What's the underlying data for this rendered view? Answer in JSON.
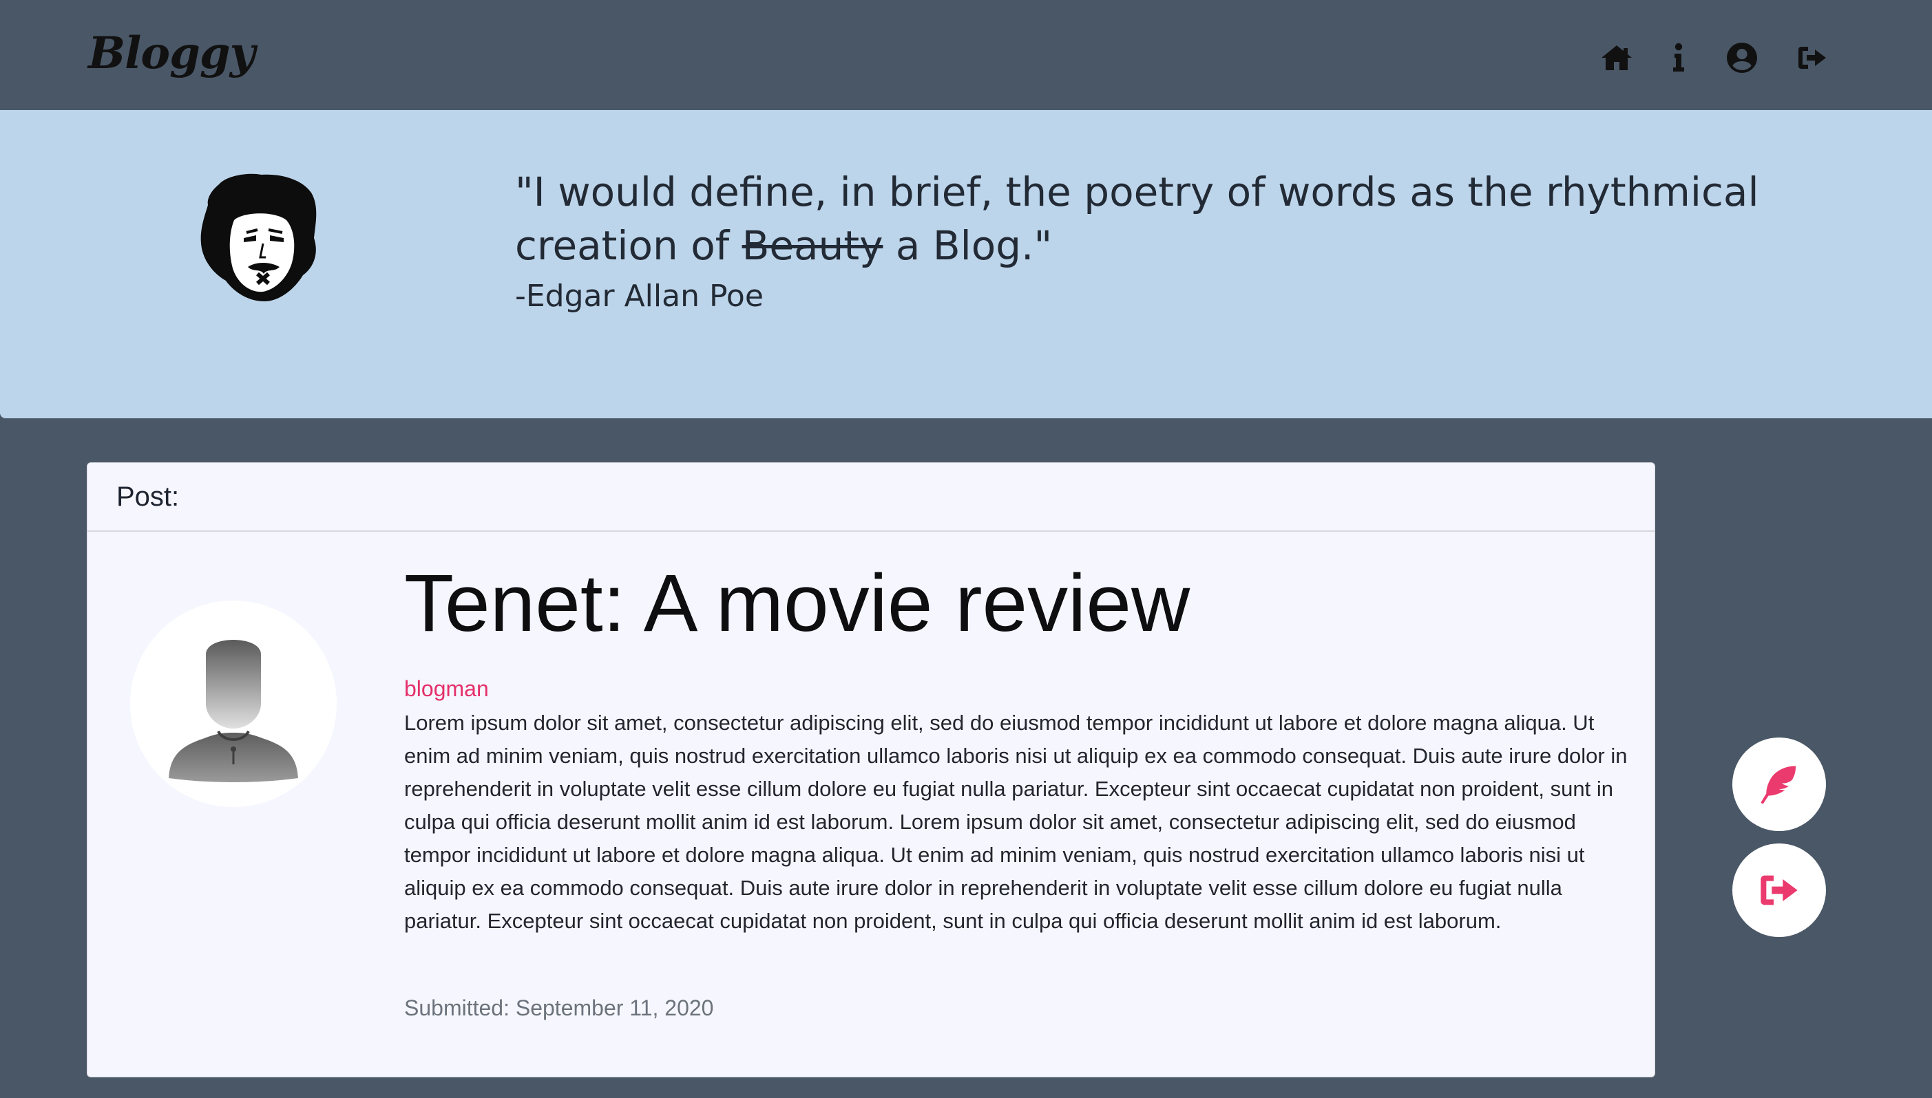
{
  "app": {
    "brand": "Bloggy"
  },
  "nav": {
    "icons": [
      "home-icon",
      "info-icon",
      "user-circle-icon",
      "sign-out-icon"
    ]
  },
  "hero": {
    "quote_start": "\"I would define, in brief, the poetry of words as the rhythmical creation of ",
    "quote_struck": "Beauty",
    "quote_end": " a Blog.\"",
    "author": "-Edgar Allan Poe"
  },
  "card": {
    "header": "Post:",
    "title": "Tenet: A movie review",
    "author": "blogman",
    "body": "Lorem ipsum dolor sit amet, consectetur adipiscing elit, sed do eiusmod tempor incididunt ut labore et dolore magna aliqua. Ut enim ad minim veniam, quis nostrud exercitation ullamco laboris nisi ut aliquip ex ea commodo consequat. Duis aute irure dolor in reprehenderit in voluptate velit esse cillum dolore eu fugiat nulla pariatur. Excepteur sint occaecat cupidatat non proident, sunt in culpa qui officia deserunt mollit anim id est laborum. Lorem ipsum dolor sit amet, consectetur adipiscing elit, sed do eiusmod tempor incididunt ut labore et dolore magna aliqua. Ut enim ad minim veniam, quis nostrud exercitation ullamco laboris nisi ut aliquip ex ea commodo consequat. Duis aute irure dolor in reprehenderit in voluptate velit esse cillum dolore eu fugiat nulla pariatur. Excepteur sint occaecat cupidatat non proident, sunt in culpa qui officia deserunt mollit anim id est laborum.",
    "submitted": "Submitted: September 11, 2020"
  },
  "fabs": {
    "icons": [
      "feather-icon",
      "sign-out-icon"
    ]
  },
  "colors": {
    "background": "#4a5767",
    "hero": "#bdd5ea",
    "card": "#f6f7fe",
    "accent": "#e4306a"
  }
}
